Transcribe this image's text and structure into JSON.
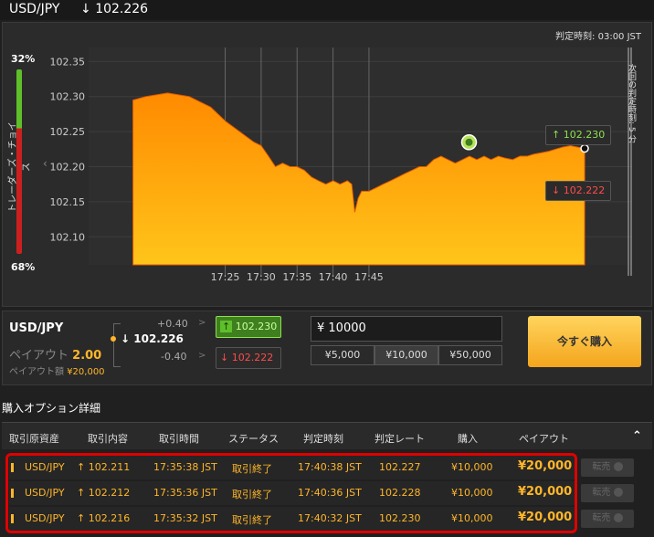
{
  "header": {
    "pair": "USD/JPY",
    "rate_arrow": "↓",
    "rate": "102.226"
  },
  "chart_panel": {
    "judge_time_label": "判定時刻:",
    "judge_time_value": "03:00 JST",
    "sentiment": {
      "top_pct": "32%",
      "bottom_pct": "68%",
      "label": "トレーダーズ・チョイス",
      "call_fraction": 0.32
    },
    "call_button": {
      "arrow": "↑",
      "value": "102.230"
    },
    "put_button": {
      "arrow": "↓",
      "value": "102.222"
    },
    "next_judge_label": "次回の判定時刻: 5 分",
    "collapse_icon": "‹"
  },
  "chart_data": {
    "type": "area",
    "ylim": [
      102.06,
      102.37
    ],
    "yticks": [
      "102.35",
      "102.30",
      "102.25",
      "102.20",
      "102.15",
      "102.10"
    ],
    "xticks": [
      "17:25",
      "17:30",
      "17:35",
      "17:40",
      "17:45"
    ],
    "grid": true,
    "series": [
      {
        "values": [
          [
            17.203,
            102.295
          ],
          [
            17.233,
            102.3
          ],
          [
            17.283,
            102.305
          ],
          [
            17.333,
            102.3
          ],
          [
            17.383,
            102.285
          ],
          [
            17.417,
            102.265
          ],
          [
            17.45,
            102.25
          ],
          [
            17.483,
            102.235
          ],
          [
            17.5,
            102.23
          ],
          [
            17.517,
            102.215
          ],
          [
            17.533,
            102.2
          ],
          [
            17.55,
            102.205
          ],
          [
            17.567,
            102.2
          ],
          [
            17.583,
            102.2
          ],
          [
            17.6,
            102.195
          ],
          [
            17.617,
            102.185
          ],
          [
            17.633,
            102.18
          ],
          [
            17.65,
            102.175
          ],
          [
            17.667,
            102.18
          ],
          [
            17.683,
            102.175
          ],
          [
            17.7,
            102.18
          ],
          [
            17.71,
            102.175
          ],
          [
            17.717,
            102.135
          ],
          [
            17.725,
            102.155
          ],
          [
            17.733,
            102.165
          ],
          [
            17.75,
            102.165
          ],
          [
            17.767,
            102.17
          ],
          [
            17.783,
            102.175
          ],
          [
            17.8,
            102.18
          ],
          [
            17.817,
            102.185
          ],
          [
            17.833,
            102.19
          ],
          [
            17.85,
            102.195
          ],
          [
            17.867,
            102.2
          ],
          [
            17.883,
            102.2
          ],
          [
            17.9,
            102.21
          ],
          [
            17.917,
            102.215
          ],
          [
            17.933,
            102.21
          ],
          [
            17.95,
            102.205
          ],
          [
            17.967,
            102.21
          ],
          [
            17.983,
            102.215
          ],
          [
            18.0,
            102.21
          ],
          [
            18.017,
            102.215
          ],
          [
            18.033,
            102.21
          ],
          [
            18.05,
            102.215
          ],
          [
            18.067,
            102.212
          ],
          [
            18.083,
            102.21
          ],
          [
            18.1,
            102.215
          ],
          [
            18.117,
            102.215
          ],
          [
            18.133,
            102.218
          ],
          [
            18.15,
            102.22
          ],
          [
            18.167,
            102.222
          ],
          [
            18.183,
            102.225
          ],
          [
            18.2,
            102.228
          ],
          [
            18.217,
            102.23
          ],
          [
            18.233,
            102.228
          ],
          [
            18.25,
            102.226
          ]
        ]
      }
    ],
    "markers": [
      {
        "x": 17.982,
        "y": 102.227
      },
      {
        "x": 18.25,
        "y": 102.226
      }
    ]
  },
  "order_panel": {
    "pair": "USD/JPY",
    "rate_arrow": "↓",
    "rate": "102.226",
    "upper_diff": "+0.40",
    "lower_diff": "-0.40",
    "chevron": ">",
    "payout_label": "ペイアウト",
    "payout_value": "2.00",
    "payout_amount_label": "ペイアウト額",
    "payout_amount": "¥20,000",
    "call_arrow": "↑",
    "call_value": "102.230",
    "put_arrow": "↓",
    "put_value": "102.222",
    "amount_input": "¥ 10000",
    "amount_buttons": [
      "¥5,000",
      "¥10,000",
      "¥50,000"
    ],
    "buy_label": "今すぐ購入"
  },
  "options": {
    "title": "購入オプション詳細",
    "headers": [
      "取引原資産",
      "取引内容",
      "取引時間",
      "ステータス",
      "判定時刻",
      "判定レート",
      "購入",
      "ペイアウト"
    ],
    "collapse_icon": "⌃",
    "rows": [
      {
        "asset": "USD/JPY",
        "arrow": "↑",
        "rate": "102.211",
        "time": "17:35:38 JST",
        "status": "取引終了",
        "judge_time": "17:40:38 JST",
        "judge_rate": "102.227",
        "buy": "¥10,000",
        "payout": "¥20,000",
        "resell": "転売"
      },
      {
        "asset": "USD/JPY",
        "arrow": "↑",
        "rate": "102.212",
        "time": "17:35:36 JST",
        "status": "取引終了",
        "judge_time": "17:40:36 JST",
        "judge_rate": "102.228",
        "buy": "¥10,000",
        "payout": "¥20,000",
        "resell": "転売"
      },
      {
        "asset": "USD/JPY",
        "arrow": "↑",
        "rate": "102.216",
        "time": "17:35:32 JST",
        "status": "取引終了",
        "judge_time": "17:40:32 JST",
        "judge_rate": "102.230",
        "buy": "¥10,000",
        "payout": "¥20,000",
        "resell": "転売"
      }
    ]
  },
  "colors": {
    "call": "#8de04f",
    "put": "#ff4b4b",
    "accent": "#ffb629",
    "area_top": "#ff8a00",
    "area_bottom": "#ffc51a"
  }
}
